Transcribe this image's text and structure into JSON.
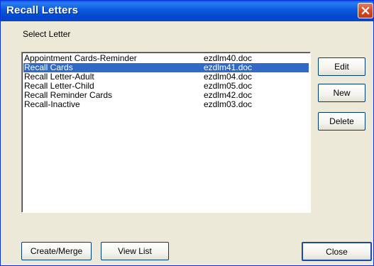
{
  "window": {
    "title": "Recall Letters"
  },
  "icons": {
    "close": "close-icon"
  },
  "label": "Select Letter",
  "letters": [
    {
      "name": "Appointment Cards-Reminder",
      "file": "ezdlm40.doc",
      "selected": false
    },
    {
      "name": "Recall Cards",
      "file": "ezdlm41.doc",
      "selected": true
    },
    {
      "name": "Recall Letter-Adult",
      "file": "ezdlm04.doc",
      "selected": false
    },
    {
      "name": "Recall Letter-Child",
      "file": "ezdlm05.doc",
      "selected": false
    },
    {
      "name": "Recall Reminder Cards",
      "file": "ezdlm42.doc",
      "selected": false
    },
    {
      "name": "Recall-Inactive",
      "file": "ezdlm03.doc",
      "selected": false
    }
  ],
  "buttons": {
    "edit": "Edit",
    "new": "New",
    "delete": "Delete",
    "create_merge": "Create/Merge",
    "view_list": "View List",
    "close": "Close"
  },
  "colors": {
    "titlebar": "#0b58dc",
    "selection": "#316ac5",
    "face": "#ece9d8"
  }
}
